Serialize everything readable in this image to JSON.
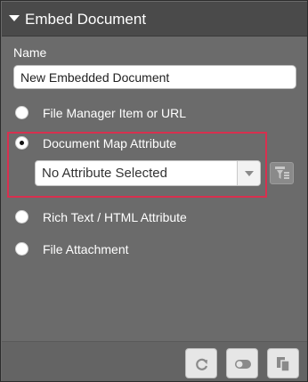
{
  "panel": {
    "title": "Embed Document"
  },
  "form": {
    "name_label": "Name",
    "name_value": "New Embedded Document",
    "options": [
      {
        "label": "File Manager Item or URL",
        "checked": false
      },
      {
        "label": "Document Map Attribute",
        "checked": true
      },
      {
        "label": "Rich Text / HTML Attribute",
        "checked": false
      },
      {
        "label": "File Attachment",
        "checked": false
      }
    ],
    "attribute_select": {
      "selected": "No Attribute Selected"
    }
  },
  "icons": {
    "collapse": "collapse-triangle-icon",
    "filter": "filter-icon",
    "refresh": "refresh-icon",
    "toggle": "toggle-icon",
    "copy": "copy-icon"
  },
  "colors": {
    "panel_bg": "#6b6b6b",
    "header_bg": "#4a4a4a",
    "highlight": "#d8304f"
  }
}
